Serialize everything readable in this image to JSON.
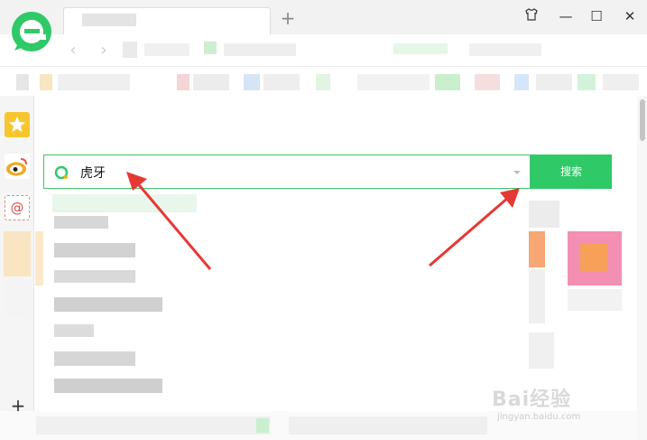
{
  "browser": {
    "accent": "#2fc968",
    "tab": {
      "title": ""
    },
    "new_tab_label": "+",
    "window_controls": {
      "skin": "shirt-icon",
      "minimize": "—",
      "maximize": "☐",
      "close": "✕"
    },
    "nav": {
      "back": "‹",
      "forward": "›"
    }
  },
  "sidebar": {
    "items": [
      {
        "icon": "star-icon",
        "color": "#f7c62f"
      },
      {
        "icon": "weibo-icon",
        "color": "#f5a623"
      },
      {
        "icon": "mail-icon",
        "color": "#e44"
      }
    ],
    "add_label": "+"
  },
  "search": {
    "query": "虎牙",
    "button_label": "搜索"
  },
  "watermark": {
    "brand": "Bai经验",
    "url": "jingyan.baidu.com"
  }
}
